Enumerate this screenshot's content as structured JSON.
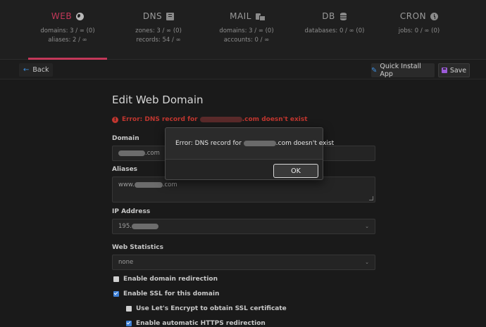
{
  "nav": {
    "tabs": [
      {
        "label": "WEB",
        "icon": "globe-icon",
        "active": true,
        "stats": [
          "domains: 3 / ∞ (0)",
          "aliases: 2 / ∞"
        ]
      },
      {
        "label": "DNS",
        "icon": "book-icon",
        "active": false,
        "stats": [
          "zones: 3 / ∞ (0)",
          "records: 54 / ∞"
        ]
      },
      {
        "label": "MAIL",
        "icon": "mail-icon",
        "active": false,
        "stats": [
          "domains: 3 / ∞ (0)",
          "accounts: 0 / ∞"
        ]
      },
      {
        "label": "DB",
        "icon": "database-icon",
        "active": false,
        "stats": [
          "databases: 0 / ∞ (0)"
        ]
      },
      {
        "label": "CRON",
        "icon": "clock-icon",
        "active": false,
        "stats": [
          "jobs: 0 / ∞ (0)"
        ]
      }
    ]
  },
  "toolbar": {
    "back_label": "Back",
    "quick_install_label": "Quick Install App",
    "save_label": "Save"
  },
  "form": {
    "title": "Edit Web Domain",
    "error_prefix": "Error: DNS record for ",
    "error_suffix": ".com doesn't exist",
    "domain_label": "Domain",
    "domain_value_suffix": ".com",
    "aliases_label": "Aliases",
    "aliases_value_prefix": "www.",
    "aliases_value_suffix": ".com",
    "ip_label": "IP Address",
    "ip_value_prefix": "195.",
    "stats_label": "Web Statistics",
    "stats_value": "none",
    "redirect_label": "Enable domain redirection",
    "ssl_label": "Enable SSL for this domain",
    "letsencrypt_label": "Use Let's Encrypt to obtain SSL certificate",
    "https_label": "Enable automatic HTTPS redirection"
  },
  "dialog": {
    "message_prefix": "Error: DNS record for ",
    "message_suffix": ".com doesn't exist",
    "ok_label": "OK"
  },
  "colors": {
    "accent": "#c33859",
    "error": "#c0362f",
    "link_blue": "#3d8fe0",
    "save_purple": "#9c5bd9"
  }
}
